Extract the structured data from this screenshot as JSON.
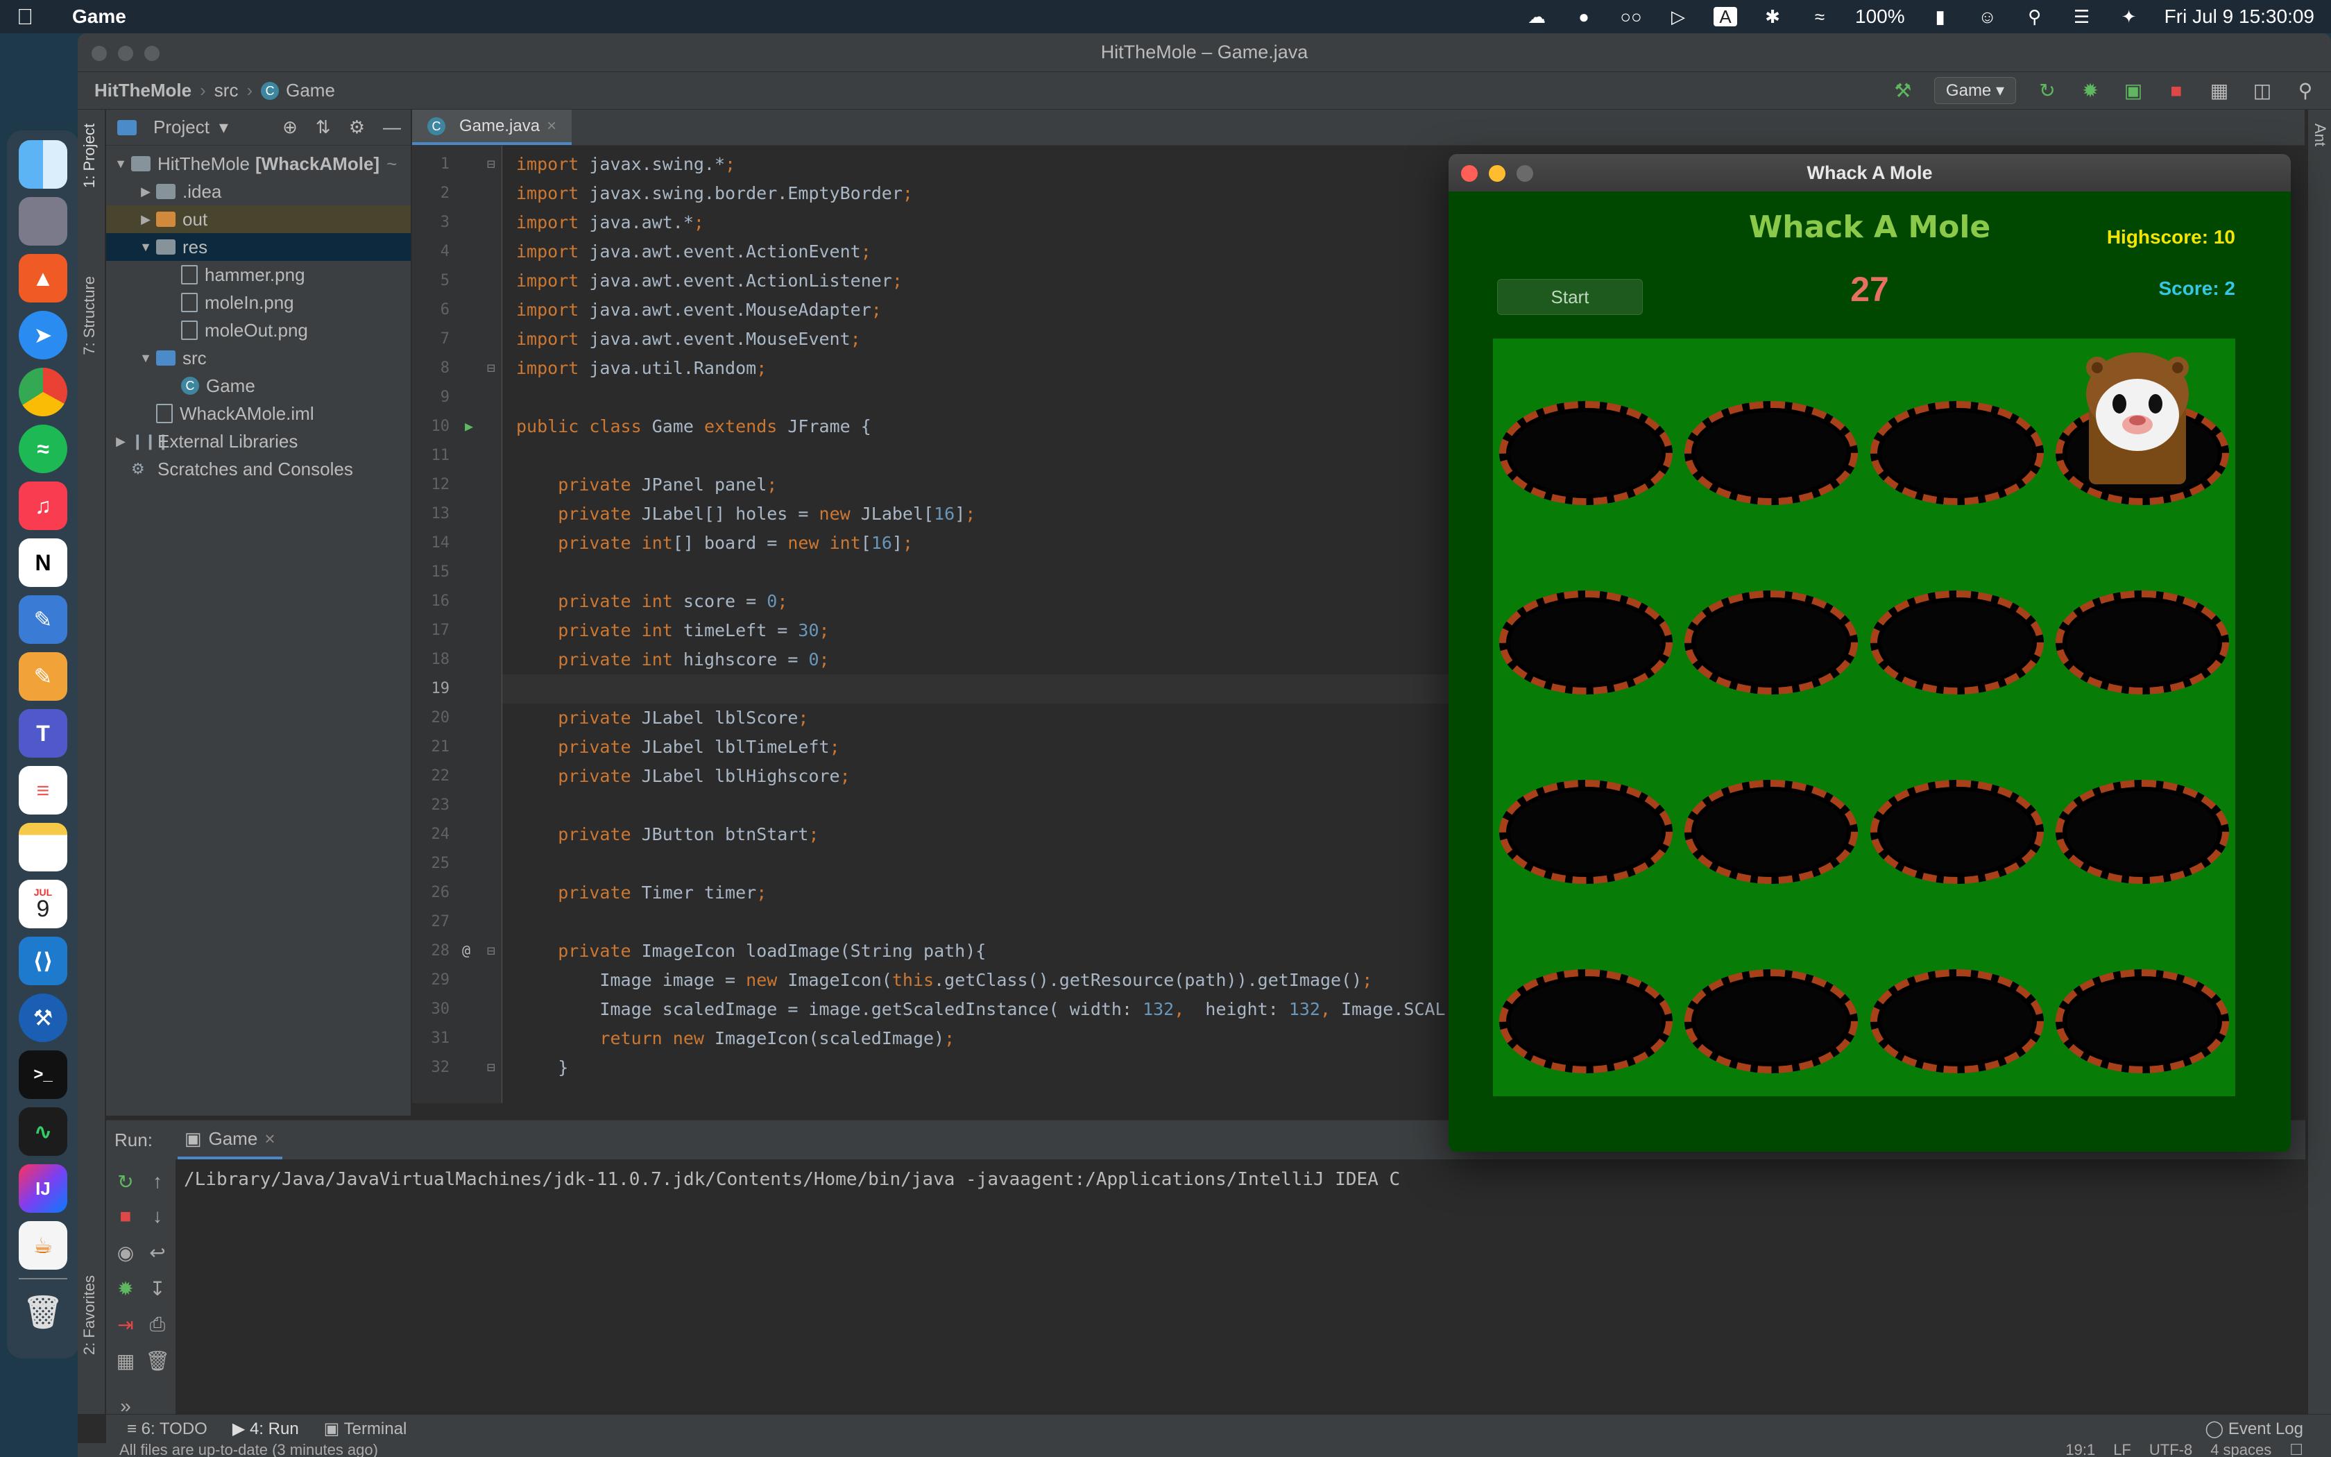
{
  "menubar": {
    "app_name": "Game",
    "battery": "100%",
    "datetime": "Fri Jul 9  15:30:09",
    "keyboard_indicator": "A"
  },
  "dock": {
    "calendar_month": "JUL",
    "calendar_day": "9",
    "apps": [
      "finder",
      "launchpad",
      "brave",
      "safari",
      "chrome",
      "spotify",
      "music",
      "notion",
      "pencil",
      "pages",
      "teams",
      "reminders",
      "notes",
      "calendar",
      "vscode",
      "xcode",
      "terminal",
      "activity-monitor",
      "intellij",
      "java",
      "trash"
    ]
  },
  "ide": {
    "window_title": "HitTheMole – Game.java",
    "breadcrumbs": [
      "HitTheMole",
      "src",
      "Game"
    ],
    "run_config": "Game",
    "left_tabs": [
      "1: Project",
      "7: Structure",
      "2: Favorites"
    ],
    "right_tabs": [
      "Ant"
    ],
    "project_panel": {
      "title": "Project",
      "tree": [
        {
          "label": "HitTheMole",
          "suffix": "[WhackAMole]",
          "trail": "~",
          "level": 0,
          "icon": "folder-gray",
          "expanded": true
        },
        {
          "label": ".idea",
          "level": 1,
          "icon": "folder-gray",
          "expanded": false
        },
        {
          "label": "out",
          "level": 1,
          "icon": "folder-orange",
          "expanded": false
        },
        {
          "label": "res",
          "level": 1,
          "icon": "folder-gray",
          "expanded": true
        },
        {
          "label": "hammer.png",
          "level": 2,
          "icon": "file"
        },
        {
          "label": "moleIn.png",
          "level": 2,
          "icon": "file"
        },
        {
          "label": "moleOut.png",
          "level": 2,
          "icon": "file"
        },
        {
          "label": "src",
          "level": 1,
          "icon": "folder-blue",
          "expanded": true
        },
        {
          "label": "Game",
          "level": 2,
          "icon": "class"
        },
        {
          "label": "WhackAMole.iml",
          "level": 1,
          "icon": "file"
        },
        {
          "label": "External Libraries",
          "level": 0,
          "icon": "bars",
          "expanded": false
        },
        {
          "label": "Scratches and Consoles",
          "level": 0,
          "icon": "scratch"
        }
      ]
    },
    "editor_tab": "Game.java",
    "code": [
      "import javax.swing.*;",
      "import javax.swing.border.EmptyBorder;",
      "import java.awt.*;",
      "import java.awt.event.ActionEvent;",
      "import java.awt.event.ActionListener;",
      "import java.awt.event.MouseAdapter;",
      "import java.awt.event.MouseEvent;",
      "import java.util.Random;",
      "",
      "public class Game extends JFrame {",
      "",
      "    private JPanel panel;",
      "    private JLabel[] holes = new JLabel[16];",
      "    private int[] board = new int[16];",
      "",
      "    private int score = 0;",
      "    private int timeLeft = 30;",
      "    private int highscore = 0;",
      "",
      "    private JLabel lblScore;",
      "    private JLabel lblTimeLeft;",
      "    private JLabel lblHighscore;",
      "",
      "    private JButton btnStart;",
      "",
      "    private Timer timer;",
      "",
      "    private ImageIcon loadImage(String path){",
      "        Image image = new ImageIcon(this.getClass().getResource(path)).getImage();",
      "        Image scaledImage = image.getScaledInstance( width: 132,  height: 132, Image.SCAL",
      "        return new ImageIcon(scaledImage);",
      "    }"
    ],
    "current_line": 19,
    "run_panel": {
      "label": "Run:",
      "tab": "Game",
      "output": "/Library/Java/JavaVirtualMachines/jdk-11.0.7.jdk/Contents/Home/bin/java -javaagent:/Applications/IntelliJ IDEA C"
    },
    "bottom_tabs": [
      "6: TODO",
      "4: Run",
      "Terminal"
    ],
    "event_log": "Event Log",
    "status": {
      "message": "All files are up-to-date (3 minutes ago)",
      "position": "19:1",
      "line_sep": "LF",
      "encoding": "UTF-8",
      "indent": "4 spaces"
    }
  },
  "game": {
    "window_title": "Whack A Mole",
    "title": "Whack A Mole",
    "highscore_label": "Highscore: 10",
    "score_label": "Score: 2",
    "time_left": "27",
    "start_button": "Start",
    "grid_rows": 4,
    "grid_cols": 4,
    "mole_hole_index": 3,
    "colors": {
      "background": "#004800",
      "board": "#077d07",
      "title": "#8ac94a",
      "highscore": "#f5e600",
      "score": "#33c8e8",
      "time": "#e87060",
      "rim": "#a8401a"
    }
  }
}
